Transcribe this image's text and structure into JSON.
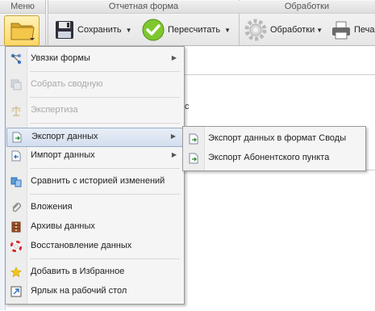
{
  "ribbon": {
    "menu_group": "Меню",
    "report_group": "Отчетная форма",
    "processing_group": "Обработки",
    "save_label": "Сохранить",
    "recalc_label": "Пересчитать",
    "processing_label": "Обработки",
    "print_label": "Печа"
  },
  "background": {
    "fragment": "c"
  },
  "menu": {
    "items": [
      {
        "label": "Увязки формы",
        "icon": "relations-icon",
        "disabled": false,
        "submenu": true
      },
      {
        "label": "Собрать сводную",
        "icon": "consolidate-icon",
        "disabled": true,
        "submenu": false
      },
      {
        "label": "Экспертиза",
        "icon": "scales-icon",
        "disabled": true,
        "submenu": false
      },
      {
        "label": "Экспорт данных",
        "icon": "export-icon",
        "disabled": false,
        "submenu": true
      },
      {
        "label": "Импорт данных",
        "icon": "import-icon",
        "disabled": false,
        "submenu": true
      },
      {
        "label": "Сравнить с историей изменений",
        "icon": "compare-icon",
        "disabled": false,
        "submenu": false
      },
      {
        "label": "Вложения",
        "icon": "paperclip-icon",
        "disabled": false,
        "submenu": false
      },
      {
        "label": "Архивы данных",
        "icon": "archive-icon",
        "disabled": false,
        "submenu": false
      },
      {
        "label": "Восстановление данных",
        "icon": "lifebuoy-icon",
        "disabled": false,
        "submenu": false
      },
      {
        "label": "Добавить в Избранное",
        "icon": "star-icon",
        "disabled": false,
        "submenu": false
      },
      {
        "label": "Ярлык на рабочий стол",
        "icon": "shortcut-icon",
        "disabled": false,
        "submenu": false
      }
    ]
  },
  "submenu": {
    "items": [
      {
        "label": "Экспорт данных в формат Своды",
        "icon": "export-doc-icon"
      },
      {
        "label": "Экспорт Абонентского пункта",
        "icon": "export-doc-icon"
      }
    ]
  },
  "colors": {
    "accent_highlight": "#d3deee",
    "disabled_text": "#a8a8a8"
  }
}
